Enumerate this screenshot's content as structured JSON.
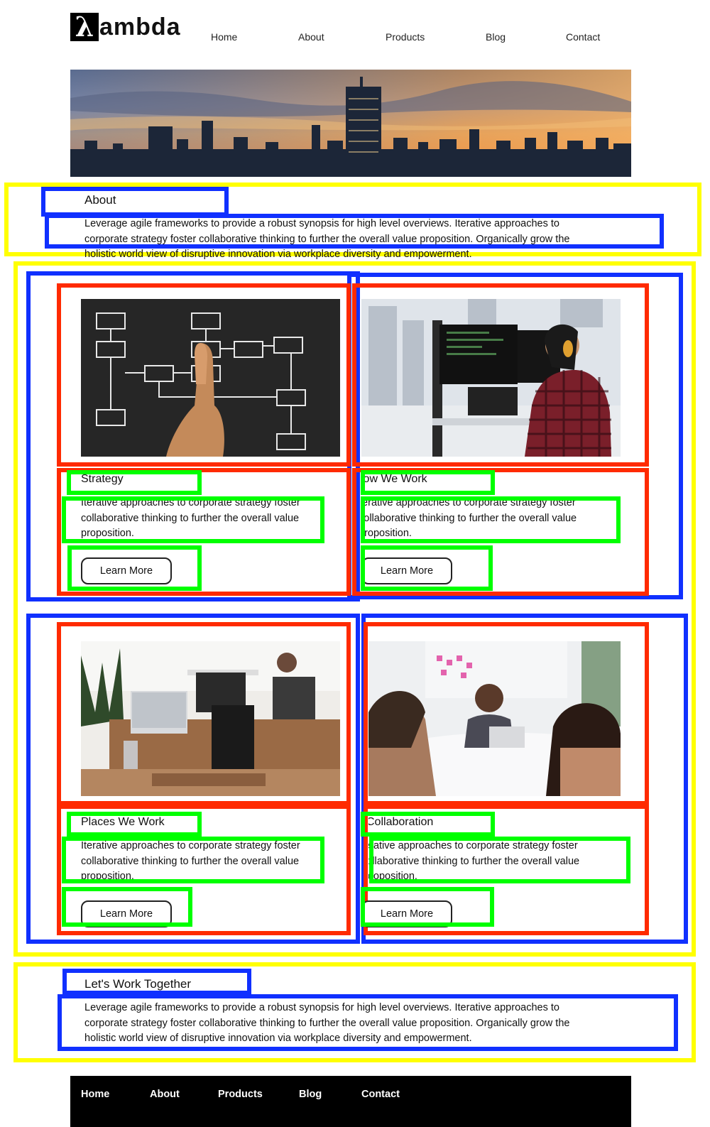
{
  "brand": {
    "mark": "λ",
    "name": "ambda"
  },
  "nav": [
    "Home",
    "About",
    "Products",
    "Blog",
    "Contact"
  ],
  "about": {
    "heading": "About",
    "lines": [
      "Leverage agile frameworks to provide a robust synopsis for high level overviews. Iterative approaches to",
      "corporate strategy foster collaborative thinking to further the overall value proposition. Organically grow the",
      "holistic world view of disruptive innovation via workplace diversity and empowerment."
    ]
  },
  "cards": [
    {
      "title": "Strategy",
      "lines": [
        "Iterative approaches to corporate strategy foster",
        "collaborative thinking to further the overall value",
        "proposition."
      ],
      "button": "Learn More"
    },
    {
      "title": "How We Work",
      "lines": [
        "Iterative approaches to corporate strategy foster",
        "collaborative thinking to further the overall value",
        "proposition."
      ],
      "button": "Learn More"
    },
    {
      "title": "Places We Work",
      "lines": [
        "Iterative approaches to corporate strategy foster",
        "collaborative thinking to further the overall value",
        "proposition."
      ],
      "button": "Learn More"
    },
    {
      "title": "Collaboration",
      "lines": [
        "Iterative approaches to corporate strategy foster",
        "collaborative thinking to further the overall value",
        "proposition."
      ],
      "button": "Learn More"
    }
  ],
  "together": {
    "heading": "Let's Work Together",
    "lines": [
      "Leverage agile frameworks to provide a robust synopsis for high level overviews. Iterative approaches to",
      "corporate strategy foster collaborative thinking to further the overall value proposition. Organically grow the",
      "holistic world view of disruptive innovation via workplace diversity and empowerment."
    ]
  },
  "footer_nav": [
    "Home",
    "About",
    "Products",
    "Blog",
    "Contact"
  ],
  "icons": {
    "logo": "lambda-logo-icon"
  },
  "colors": {
    "outline_section": "#ffff00",
    "outline_group": "#1030ff",
    "outline_card": "#ff2a00",
    "outline_element": "#00ff00",
    "footer_bg": "#000000"
  }
}
